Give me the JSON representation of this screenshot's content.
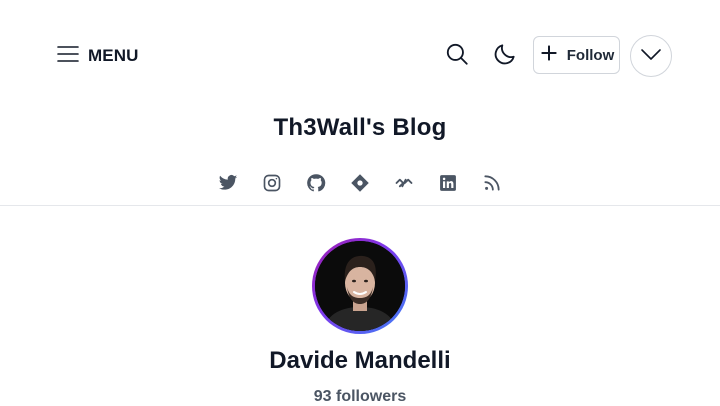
{
  "header": {
    "menu_label": "MENU",
    "follow_label": "Follow",
    "icons": {
      "menu": "hamburger-icon",
      "search": "search-icon",
      "theme": "moon-icon",
      "follow": "plus-icon",
      "more": "chevron-down-icon"
    }
  },
  "blog": {
    "title": "Th3Wall's Blog"
  },
  "socials": [
    {
      "name": "twitter-icon"
    },
    {
      "name": "instagram-icon"
    },
    {
      "name": "github-icon"
    },
    {
      "name": "website-icon"
    },
    {
      "name": "link-icon"
    },
    {
      "name": "linkedin-icon"
    },
    {
      "name": "rss-icon"
    }
  ],
  "author": {
    "name": "Davide Mandelli",
    "followers": "93 followers"
  },
  "colors": {
    "text": "#111827",
    "muted": "#4b5563",
    "icon": "#4b5563",
    "border": "#d1d5db",
    "avatar_gradient": [
      "#a21caf",
      "#7c3aed",
      "#3b82f6"
    ]
  }
}
